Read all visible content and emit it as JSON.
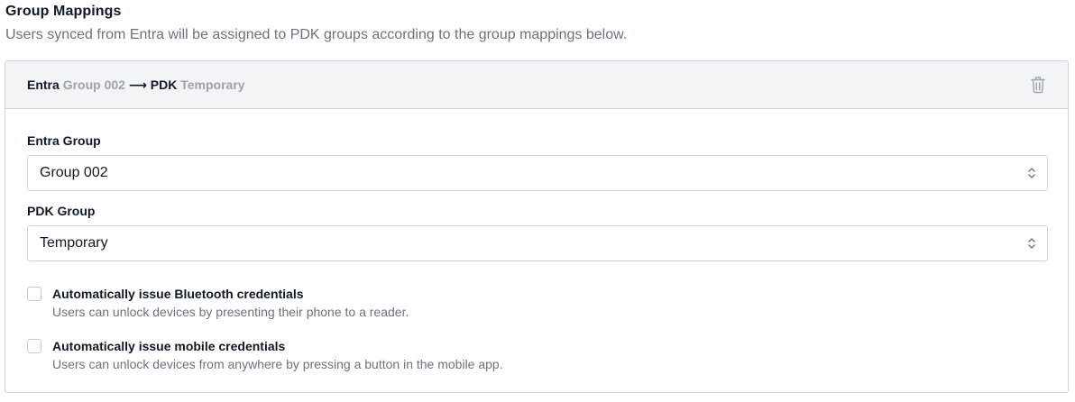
{
  "section": {
    "title": "Group Mappings",
    "description": "Users synced from Entra will be assigned to PDK groups according to the group mappings below."
  },
  "mapping": {
    "header": {
      "source_label": "Entra",
      "source_value": "Group 002",
      "arrow": "⟶",
      "target_label": "PDK",
      "target_value": "Temporary",
      "delete_icon": "trash-icon"
    },
    "entra_group": {
      "label": "Entra Group",
      "value": "Group 002"
    },
    "pdk_group": {
      "label": "PDK Group",
      "value": "Temporary"
    },
    "options": [
      {
        "title": "Automatically issue Bluetooth credentials",
        "description": "Users can unlock devices by presenting their phone to a reader.",
        "checked": false
      },
      {
        "title": "Automatically issue mobile credentials",
        "description": "Users can unlock devices from anywhere by pressing a button in the mobile app.",
        "checked": false
      }
    ]
  }
}
